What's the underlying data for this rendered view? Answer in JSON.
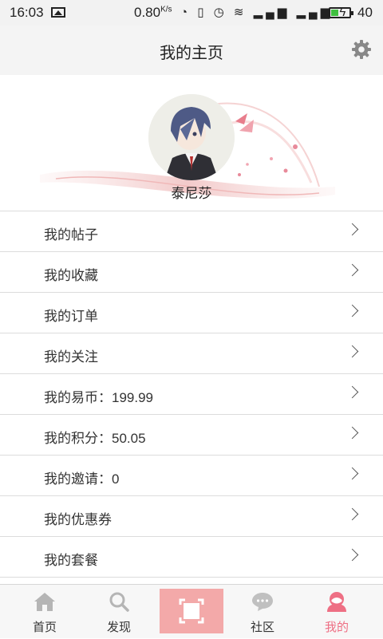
{
  "status_bar": {
    "time": "16:03",
    "speed": "0.80",
    "speed_unit": "K/s",
    "battery_level": "40",
    "battery_fraction": 0.4
  },
  "header": {
    "title": "我的主页"
  },
  "profile": {
    "name": "泰尼莎"
  },
  "menu": [
    {
      "label": "我的帖子"
    },
    {
      "label": "我的收藏"
    },
    {
      "label": "我的订单"
    },
    {
      "label": "我的关注"
    },
    {
      "label": "我的易币：199.99"
    },
    {
      "label": "我的积分：50.05"
    },
    {
      "label": "我的邀请：0"
    },
    {
      "label": "我的优惠券"
    },
    {
      "label": "我的套餐"
    }
  ],
  "tabs": [
    {
      "label": "首页",
      "icon": "home-icon"
    },
    {
      "label": "发现",
      "icon": "search-icon"
    },
    {
      "label": "",
      "icon": "scan-icon"
    },
    {
      "label": "社区",
      "icon": "chat-bubble-icon"
    },
    {
      "label": "我的",
      "icon": "user-icon",
      "active": true
    }
  ],
  "colors": {
    "accent": "#ee6f84",
    "scan_button": "#f3a9a9",
    "header_bg": "#f4f4f4"
  }
}
